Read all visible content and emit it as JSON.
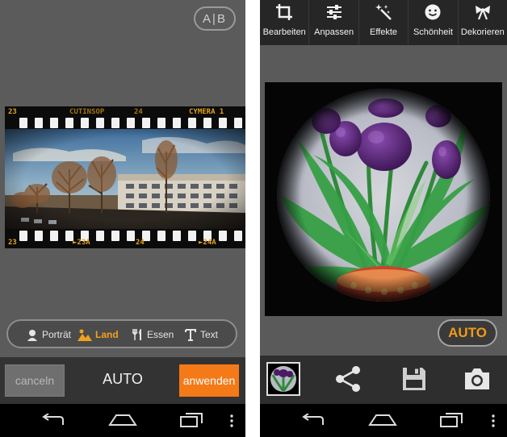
{
  "left_screen": {
    "ab_toggle_label": "A|B",
    "film": {
      "top_left": "23",
      "top_mid1": "CUTINSOP",
      "top_mid2": "24",
      "top_right": "CYMERA 1",
      "bottom_left": "23",
      "bottom_mid1": "►23A",
      "bottom_mid2": "24",
      "bottom_right": "►24A"
    },
    "scene_modes": [
      {
        "label": "Porträt",
        "icon": "portrait-icon",
        "active": false
      },
      {
        "label": "Land",
        "icon": "landscape-icon",
        "active": true
      },
      {
        "label": "Essen",
        "icon": "fork-knife-icon",
        "active": false
      },
      {
        "label": "Text",
        "icon": "text-icon",
        "active": false
      }
    ],
    "cancel_label": "canceln",
    "mode_label": "AUTO",
    "apply_label": "anwenden"
  },
  "right_screen": {
    "toolbar": [
      {
        "label": "Bearbeiten",
        "icon": "crop-icon"
      },
      {
        "label": "Anpassen",
        "icon": "sliders-icon"
      },
      {
        "label": "Effekte",
        "icon": "magic-wand-icon"
      },
      {
        "label": "Schönheit",
        "icon": "smiley-icon"
      },
      {
        "label": "Dekorieren",
        "icon": "bow-icon"
      }
    ],
    "auto_label": "AUTO",
    "bottom_actions": [
      "thumbnail",
      "share-icon",
      "save-icon",
      "camera-icon"
    ]
  },
  "colors": {
    "accent_orange": "#f47a18",
    "active_orange": "#f0a21c",
    "background_gray": "#5b5b5b",
    "panel_dark": "#333333"
  }
}
